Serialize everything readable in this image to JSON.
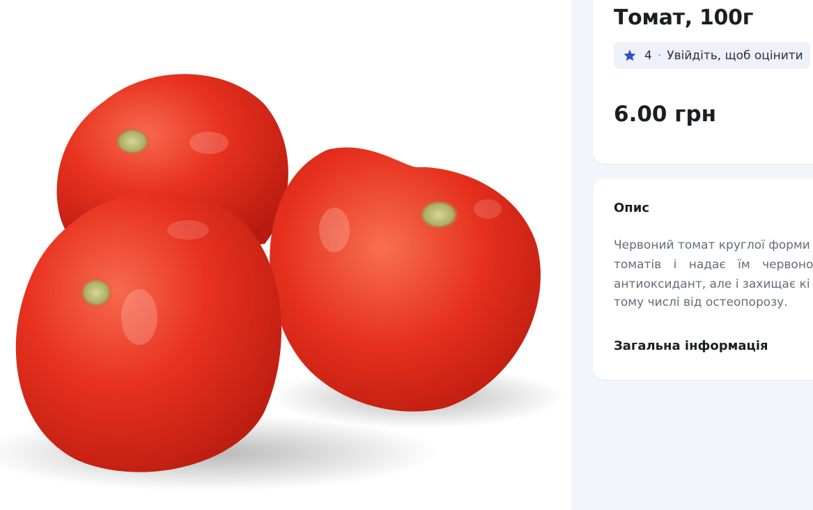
{
  "product": {
    "title": "Томат, 100г",
    "rating_value": "4",
    "rating_separator": "·",
    "rating_prompt": "Увійдіть, щоб оцінити",
    "price": "6.00 грн"
  },
  "description": {
    "heading": "Опис",
    "lines": [
      "Червоний томат круглої форми",
      "томатів і надає їм червоного",
      "антиоксидант, але і захищає кі",
      "тому числі від остеопорозу."
    ]
  },
  "general_info": {
    "heading": "Загальна інформація"
  },
  "icons": {
    "rating": "star-icon"
  },
  "colors": {
    "star": "#2f4fd0",
    "panel_background": "#f3f5fa",
    "card_background": "#ffffff",
    "tomato": "#e8321f"
  }
}
